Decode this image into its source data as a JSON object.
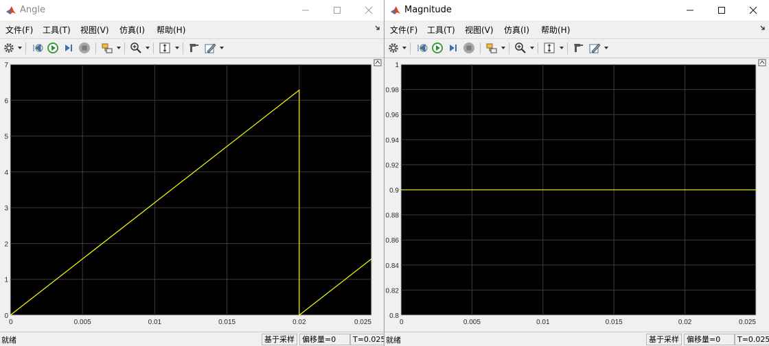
{
  "colors": {
    "axes_bg": "#000000",
    "grid": "#3c3c3c",
    "trace": "#ffff00",
    "trace_flat": "#e8e020",
    "frame_bg": "#f0f0f0"
  },
  "menu": [
    "文件(F)",
    "工具(T)",
    "视图(V)",
    "仿真(I)",
    "帮助(H)"
  ],
  "icons": [
    "settings-gear-icon",
    "step-back-icon",
    "run-icon",
    "step-forward-icon",
    "stop-icon",
    "highlight-block-icon",
    "zoom-in-icon",
    "scale-y-axis-icon",
    "style-icon",
    "edit-measurement-icon"
  ],
  "windows": {
    "angle": {
      "title": "Angle",
      "status": {
        "ready": "就绪",
        "sample": "基于采样",
        "offset": "偏移量=0",
        "time": "T=0.025"
      }
    },
    "magnitude": {
      "title": "Magnitude",
      "status": {
        "ready": "就绪",
        "sample": "基于采样",
        "offset": "偏移量=0",
        "time": "T=0.025"
      }
    }
  },
  "chart_data": [
    {
      "type": "line",
      "x_ticks": [
        "0",
        "0.005",
        "0.01",
        "0.015",
        "0.02",
        "0.025"
      ],
      "y_ticks": [
        "0",
        "1",
        "2",
        "3",
        "4",
        "5",
        "6",
        "7"
      ],
      "xlim": [
        0,
        0.025
      ],
      "ylim": [
        0,
        7
      ],
      "grid": true,
      "series": [
        {
          "x": [
            0,
            0.02,
            0.02,
            0.025
          ],
          "y": [
            0,
            6.2832,
            0,
            1.5708
          ]
        }
      ]
    },
    {
      "type": "line",
      "x_ticks": [
        "0",
        "0.005",
        "0.01",
        "0.015",
        "0.02",
        "0.025"
      ],
      "y_ticks": [
        "0.8",
        "0.82",
        "0.84",
        "0.86",
        "0.88",
        "0.9",
        "0.92",
        "0.94",
        "0.96",
        "0.98",
        "1"
      ],
      "xlim": [
        0,
        0.025
      ],
      "ylim": [
        0.8,
        1
      ],
      "grid": true,
      "series": [
        {
          "x": [
            0,
            0.025
          ],
          "y": [
            0.9,
            0.9
          ]
        }
      ]
    }
  ]
}
